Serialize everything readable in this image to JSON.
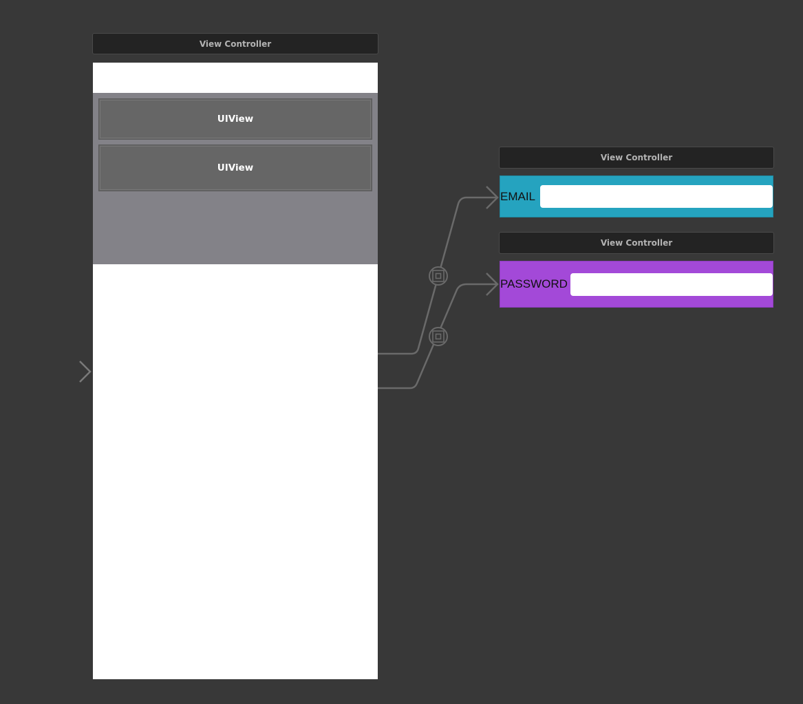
{
  "main_scene": {
    "header_title": "View Controller",
    "subviews": [
      {
        "label": "UIView"
      },
      {
        "label": "UIView"
      }
    ]
  },
  "email_scene": {
    "header_title": "View Controller",
    "label": "EMAIL",
    "background_color": "#25a3bf",
    "input_value": ""
  },
  "password_scene": {
    "header_title": "View Controller",
    "label": "PASSWORD",
    "background_color": "#a349d8",
    "input_value": ""
  },
  "canvas_background": "#383838",
  "icons": {
    "entry_point": "entry-arrow-icon",
    "segue_embed": "embed-segue-icon"
  }
}
